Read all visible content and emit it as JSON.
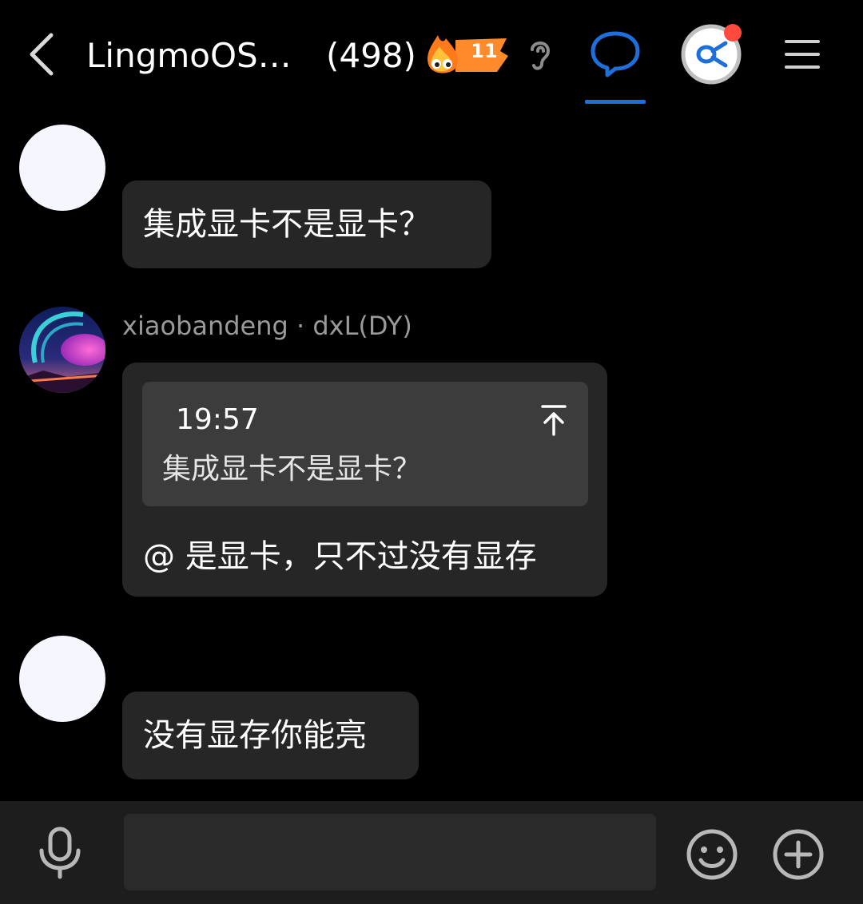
{
  "header": {
    "title": "LingmoOS…",
    "member_count": "(498)",
    "fire_level": "11",
    "icons": {
      "back": "chevron-left-icon",
      "ear": "ear-icon",
      "chat": "chat-bubble-icon",
      "app": "app-avatar-icon",
      "menu": "hamburger-menu-icon"
    },
    "accent_color": "#1e6fd9",
    "notification_color": "#ff4a3d"
  },
  "messages": [
    {
      "text": "集成显卡不是显卡？"
    },
    {
      "sender": "xiaobandeng · dxL(DY)",
      "quote": {
        "time": "19:57",
        "text": "集成显卡不是显卡？"
      },
      "text": "@  是显卡，只不过没有显存"
    },
    {
      "text": "没有显存你能亮"
    }
  ],
  "input_bar": {
    "value": "",
    "icons": {
      "mic": "microphone-icon",
      "emoji": "smiley-icon",
      "plus": "plus-circle-icon"
    }
  }
}
